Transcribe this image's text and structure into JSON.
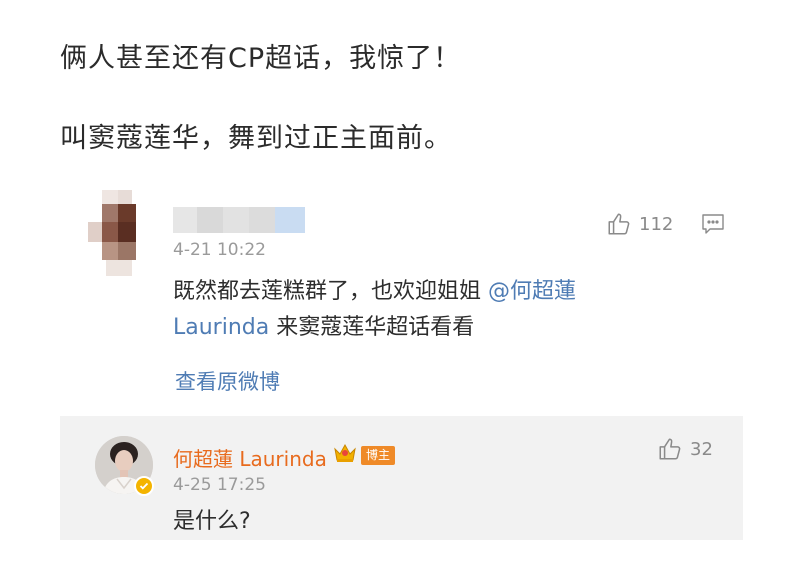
{
  "post": {
    "line1": "俩人甚至还有CP超话，我惊了！",
    "line2": "叫窦蔻莲华，舞到过正主面前。"
  },
  "comment": {
    "time": "4-21 10:22",
    "text_line1": "既然都去莲糕群了，也欢迎姐姐 ",
    "mention_line1": "@何超蓮",
    "mention_line2": "Laurinda",
    "text_line2": " 来窦蔻莲华超话看看",
    "like_count": "112",
    "view_original": "查看原微博"
  },
  "reply": {
    "author": "何超蓮 Laurinda",
    "badge": "博主",
    "time": "4-25 17:25",
    "text": "是什么?",
    "like_count": "32"
  },
  "colors": {
    "link": "#4f7cb4",
    "author": "#e86b1e",
    "badge": "#ef8a28",
    "reply_bg": "#f2f2f2"
  },
  "icons": [
    "thumbs-up-icon",
    "comment-icon",
    "crown-icon",
    "verified-badge-icon"
  ]
}
